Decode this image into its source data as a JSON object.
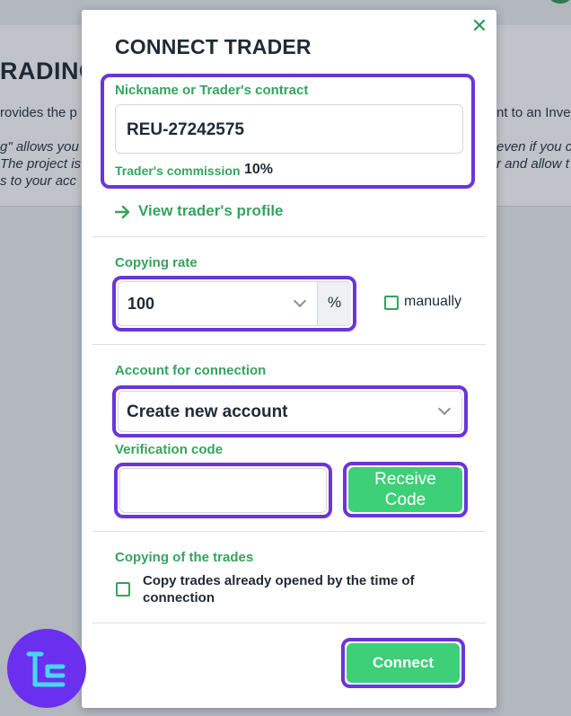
{
  "background": {
    "heading": "RADING",
    "line1_left": "rovides the p",
    "line1_right": "nt to an Inve",
    "line2_left": "g\" allows you",
    "line2_right": "even if you c",
    "line3_left": "The project is",
    "line3_right": "r and allow t",
    "line4_left": "s to your acc"
  },
  "modal": {
    "title": "CONNECT TRADER",
    "close_icon": "close-icon",
    "nickname_label": "Nickname or Trader's contract",
    "nickname_value": "REU-27242575",
    "commission_label": "Trader's commission",
    "commission_value": "10%",
    "view_profile_label": "View trader's profile",
    "copying_rate_label": "Copying rate",
    "copying_rate_value": "100",
    "percent_unit": "%",
    "manually_label": "manually",
    "account_label": "Account for connection",
    "account_value": "Create new account",
    "verification_label": "Verification code",
    "verification_value": "",
    "receive_code_line1": "Receive",
    "receive_code_line2": "Code",
    "copying_trades_label": "Copying of the trades",
    "copy_opened_line1": "Copy trades already opened by the time of",
    "copy_opened_line2": "connection",
    "connect_label": "Connect"
  },
  "colors": {
    "accent_green": "#36a35e",
    "button_green": "#3ecf79",
    "highlight_purple": "#6b35d9",
    "logo_purple": "#6b2ff0",
    "logo_cyan": "#45d8f2"
  }
}
